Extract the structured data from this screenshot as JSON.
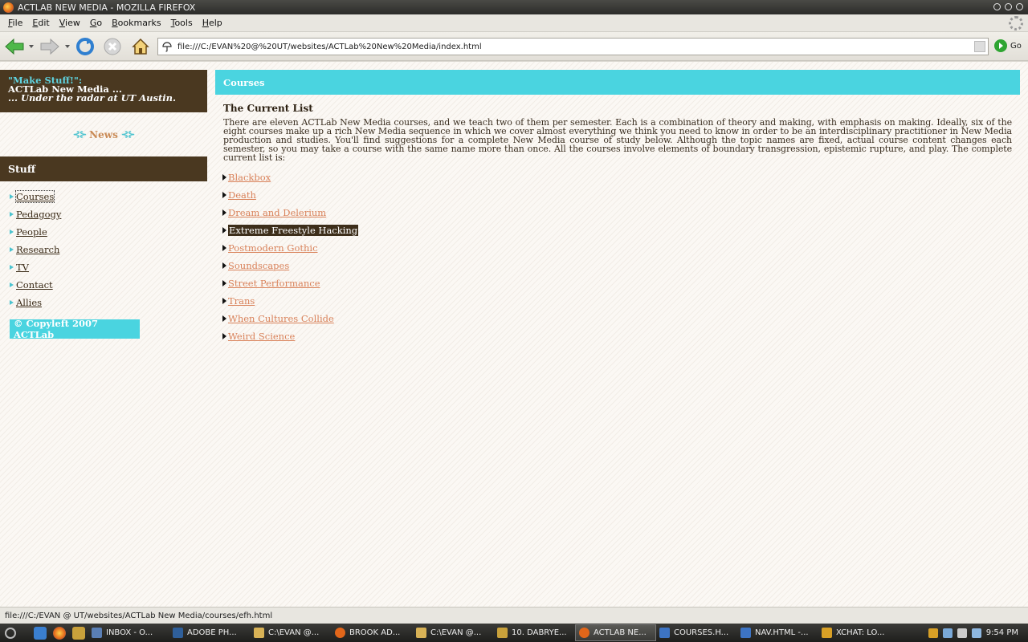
{
  "window": {
    "title": "ACTLAB NEW MEDIA - MOZILLA FIREFOX"
  },
  "menubar": {
    "items": [
      "File",
      "Edit",
      "View",
      "Go",
      "Bookmarks",
      "Tools",
      "Help"
    ]
  },
  "toolbar": {
    "url": "file:///C:/EVAN%20@%20UT/websites/ACTLab%20New%20Media/index.html",
    "go_label": "Go"
  },
  "sidebar": {
    "tagline": "\"Make Stuff!\":",
    "site_name": "ACTLab New Media ...",
    "subtitle": "... Under the radar at UT Austin.",
    "news_label": "News",
    "stuff_heading": "Stuff",
    "items": [
      {
        "label": "Courses",
        "active": true
      },
      {
        "label": "Pedagogy"
      },
      {
        "label": "People"
      },
      {
        "label": "Research"
      },
      {
        "label": "TV"
      },
      {
        "label": "Contact"
      },
      {
        "label": "Allies"
      }
    ],
    "copyleft": "© Copyleft 2007 ACTLab"
  },
  "main": {
    "heading": "Courses",
    "subheading": "The Current List",
    "intro": "There are eleven ACTLab New Media courses, and we teach two of them per semester. Each is a combination of theory and making, with emphasis on making. Ideally, six of the eight courses make up a rich New Media sequence in which we cover almost everything we think you need to know in order to be an interdisciplinary practitioner in New Media production and studies. You'll find suggestions for a complete New Media course of study below. Although the topic names are fixed, actual course content changes each semester, so you may take a course with the same name more than once. All the courses involve elements of boundary transgression, epistemic rupture, and play. The complete current list is:",
    "courses": [
      "Blackbox",
      "Death",
      "Dream and Delerium",
      "Extreme Freestyle Hacking",
      "Postmodern Gothic",
      "Soundscapes",
      "Street Performance",
      "Trans",
      "When Cultures Collide",
      "Weird Science"
    ],
    "hovered_course": "Extreme Freestyle Hacking"
  },
  "statusbar": {
    "text": "file:///C:/EVAN @ UT/websites/ACTLab New Media/courses/efh.html"
  },
  "taskbar": {
    "tasks": [
      {
        "label": "INBOX - O...",
        "icon": "mail-icon",
        "color": "#5a7fb5"
      },
      {
        "label": "ADOBE PH...",
        "icon": "photoshop-icon",
        "color": "#2f5f9a"
      },
      {
        "label": "C:\\EVAN @...",
        "icon": "folder-icon",
        "color": "#d8b256"
      },
      {
        "label": "BROOK AD...",
        "icon": "firefox-icon",
        "color": "#e2661a"
      },
      {
        "label": "C:\\EVAN @...",
        "icon": "folder-icon",
        "color": "#d8b256"
      },
      {
        "label": "10. DABRYE...",
        "icon": "music-icon",
        "color": "#c9a13b"
      },
      {
        "label": "ACTLAB NE...",
        "icon": "firefox-icon",
        "color": "#e2661a",
        "active": true
      },
      {
        "label": "COURSES.H...",
        "icon": "document-icon",
        "color": "#3d74c4"
      },
      {
        "label": "NAV.HTML -...",
        "icon": "document-icon",
        "color": "#3d74c4"
      },
      {
        "label": "XCHAT: LO...",
        "icon": "xchat-icon",
        "color": "#d8a026"
      }
    ],
    "clock": "9:54 PM"
  }
}
